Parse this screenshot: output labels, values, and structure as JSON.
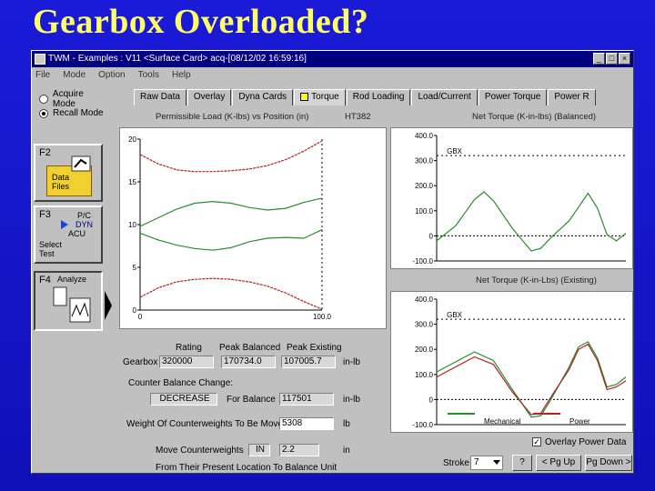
{
  "slide": {
    "title": "Gearbox Overloaded?"
  },
  "window": {
    "title": "TWM - Examples : V11 <Surface Card> acq-[08/12/02 16:59:16]",
    "min": "_",
    "max": "□",
    "close": "×"
  },
  "menu": [
    "File",
    "Mode",
    "Option",
    "Tools",
    "Help"
  ],
  "modes": {
    "acquire": "Acquire Mode",
    "recall": "Recall Mode"
  },
  "fkeys": [
    {
      "key": "F2",
      "label": "Data Files"
    },
    {
      "key": "F3",
      "label": "Select Test",
      "items": [
        "P/C",
        "DYN",
        "ACU"
      ]
    },
    {
      "key": "F4",
      "label": "Analyze"
    }
  ],
  "tabs": [
    "Raw Data",
    "Overlay",
    "Dyna Cards",
    "Torque",
    "Rod Loading",
    "Load/Current",
    "Power Torque",
    "Power R"
  ],
  "charts": {
    "left": {
      "title": "Permissible Load (K-lbs) vs Position (in)",
      "tag": "HT382",
      "yticks": [
        "20",
        "15",
        "10",
        "5",
        "0"
      ],
      "xticks": [
        "0",
        "100.0"
      ]
    },
    "right_top": {
      "title": "Net Torque (K-in-lbs) (Balanced)",
      "yticks": [
        "400.0",
        "300.0",
        "200.0",
        "100.0",
        "0",
        "-100.0"
      ],
      "ref_label": "GBX"
    },
    "right_bottom": {
      "title": "Net Torque (K-in-Lbs) (Existing)",
      "yticks": [
        "400.0",
        "300.0",
        "200.0",
        "100.0",
        "0",
        "-100.0"
      ],
      "ref_label": "GBX",
      "legend": [
        "Mechanical",
        "Power"
      ]
    }
  },
  "chart_data": [
    {
      "type": "line",
      "title": "Permissible Load (K-lbs) vs Position (in)",
      "xlim": [
        0,
        100
      ],
      "ylim": [
        0,
        20
      ],
      "series": [
        {
          "name": "",
          "x": [
            0,
            10,
            20,
            30,
            40,
            50,
            60,
            70,
            80,
            90,
            100
          ],
          "y": [
            18.2,
            17.1,
            16.4,
            16.2,
            16.2,
            16.3,
            16.5,
            16.9,
            17.6,
            18.6,
            19.8
          ]
        },
        {
          "name": "",
          "x": [
            0,
            10,
            20,
            30,
            40,
            50,
            60,
            70,
            80,
            90,
            100
          ],
          "y": [
            1.5,
            2.6,
            3.3,
            3.6,
            3.7,
            3.6,
            3.3,
            2.8,
            2.0,
            1.0,
            0.1
          ]
        },
        {
          "name": "",
          "x": [
            0,
            10,
            20,
            30,
            40,
            50,
            60,
            70,
            80,
            90,
            100
          ],
          "y": [
            9.8,
            10.8,
            11.8,
            12.5,
            12.7,
            12.5,
            12.0,
            11.7,
            11.9,
            12.6,
            13.1
          ]
        },
        {
          "name": "",
          "x": [
            0,
            10,
            20,
            30,
            40,
            50,
            60,
            70,
            80,
            90,
            100
          ],
          "y": [
            9.0,
            8.2,
            7.6,
            7.2,
            7.0,
            7.3,
            8.0,
            8.4,
            8.5,
            8.4,
            9.4
          ]
        }
      ]
    },
    {
      "type": "line",
      "title": "Net Torque (K-in-lbs) (Balanced)",
      "xlim": [
        0,
        100
      ],
      "ylim": [
        -100,
        400
      ],
      "gbx": 320,
      "series": [
        {
          "name": "",
          "x": [
            0,
            10,
            20,
            25,
            30,
            40,
            50,
            55,
            60,
            70,
            75,
            80,
            85,
            90,
            95,
            100
          ],
          "y": [
            -20,
            40,
            145,
            175,
            140,
            30,
            -60,
            -50,
            -10,
            60,
            115,
            170,
            110,
            5,
            -20,
            10
          ]
        }
      ]
    },
    {
      "type": "line",
      "title": "Net Torque (K-in-Lbs) (Existing)",
      "xlim": [
        0,
        100
      ],
      "ylim": [
        -100,
        400
      ],
      "gbx": 320,
      "series": [
        {
          "name": "Mechanical",
          "x": [
            0,
            10,
            20,
            30,
            40,
            50,
            55,
            60,
            70,
            75,
            80,
            85,
            90,
            95,
            100
          ],
          "y": [
            110,
            150,
            190,
            155,
            40,
            -70,
            -65,
            -5,
            130,
            210,
            230,
            165,
            50,
            60,
            90
          ]
        },
        {
          "name": "Power",
          "x": [
            0,
            10,
            20,
            30,
            40,
            50,
            55,
            60,
            70,
            75,
            80,
            85,
            90,
            95,
            100
          ],
          "y": [
            90,
            130,
            170,
            140,
            30,
            -60,
            -55,
            5,
            120,
            200,
            220,
            155,
            40,
            50,
            75
          ]
        }
      ]
    }
  ],
  "gearbox": {
    "headers": [
      "Rating",
      "Peak Balanced",
      "Peak Existing"
    ],
    "label": "Gearbox",
    "rating": "320000",
    "peak_balanced": "170734.0",
    "peak_existing": "107005.7",
    "unit": "in-lb"
  },
  "counter": {
    "heading": "Counter Balance Change:",
    "change": "DECREASE",
    "for_balance_label": "For Balance",
    "for_balance_value": "117501",
    "for_balance_unit": "in-lb",
    "weight_label": "Weight Of Counterweights To Be Moved",
    "weight_value": "5308",
    "weight_unit": "lb",
    "move_label": "Move Counterweights",
    "move_dir": "IN",
    "move_value": "2.2",
    "move_unit": "in",
    "footer": "From Their Present Location To Balance Unit"
  },
  "controls": {
    "overlay_label": "Overlay Power Data",
    "overlay_checked": "✓",
    "stroke_label": "Stroke",
    "stroke_value": "7",
    "help": "?",
    "pgup": "< Pg Up",
    "pgdown": "Pg Down >"
  },
  "colors": {
    "bg": "#1b1bd8",
    "title": "#ffff66",
    "series_green": "#2e8b2e",
    "series_red": "#b22222"
  }
}
